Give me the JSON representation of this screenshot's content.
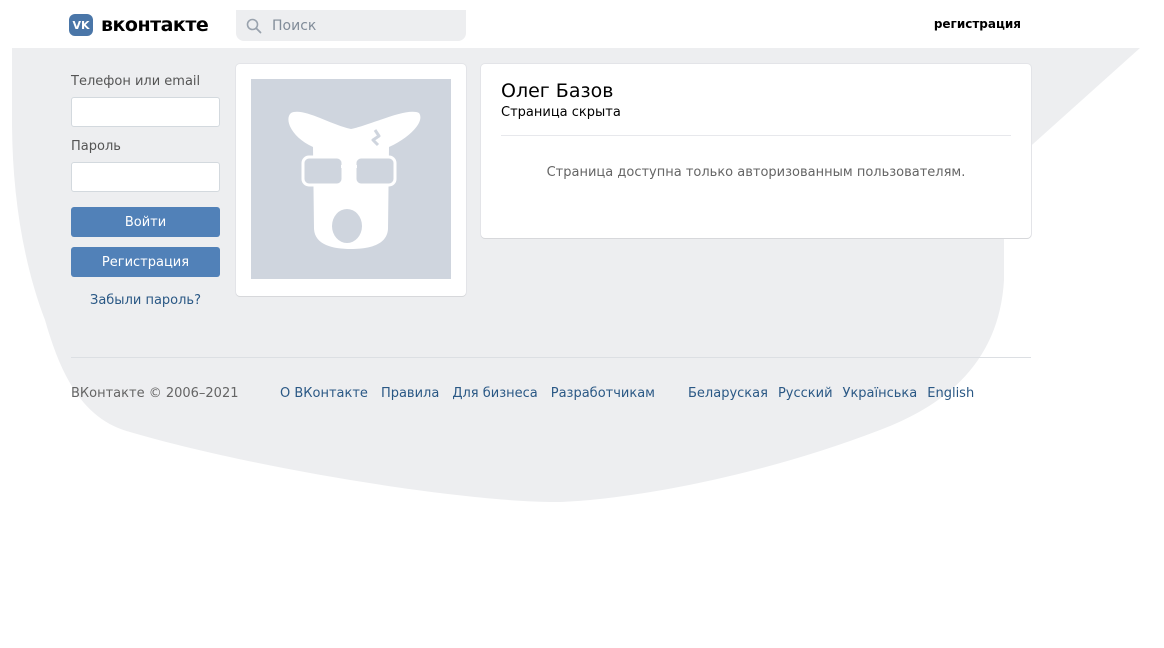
{
  "header": {
    "logo_mark": "VK",
    "logo_text": "вконтакте",
    "search_placeholder": "Поиск",
    "register_link": "регистрация"
  },
  "login": {
    "phone_label": "Телефон или email",
    "password_label": "Пароль",
    "login_button": "Войти",
    "register_button": "Регистрация",
    "forgot_link": "Забыли пароль?"
  },
  "profile": {
    "name": "Олег Базов",
    "status": "Страница скрыта",
    "message": "Страница доступна только авторизованным пользователям."
  },
  "footer": {
    "copyright": "ВКонтакте © 2006–2021",
    "links": [
      "О ВКонтакте",
      "Правила",
      "Для бизнеса",
      "Разработчикам"
    ],
    "languages": [
      "Беларуская",
      "Русский",
      "Українська",
      "English"
    ]
  },
  "colors": {
    "accent": "#5181b8",
    "brand": "#4a76a8",
    "link": "#2a5885",
    "page_background": "#edeef0"
  }
}
